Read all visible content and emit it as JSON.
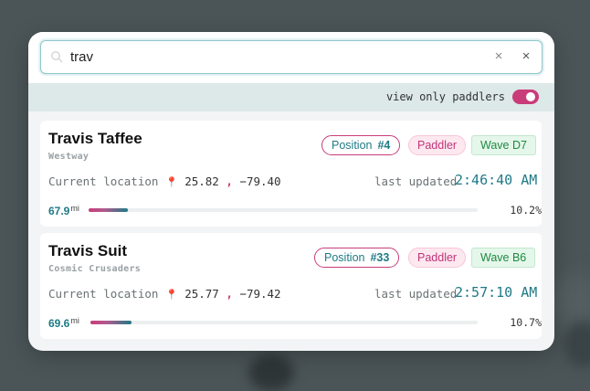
{
  "search": {
    "value": "trav",
    "placeholder": "",
    "icon": "search-icon",
    "clear_label": "×",
    "close_label": "×"
  },
  "filter": {
    "label": "view only paddlers",
    "toggle_on": true
  },
  "results": [
    {
      "name": "Travis Taffee",
      "team": "Westway",
      "position_label": "Position",
      "position_value": "#4",
      "role": "Paddler",
      "wave": "Wave D7",
      "location_label": "Current location",
      "lat": "25.82",
      "lon": "−79.40",
      "updated_label": "last updated",
      "updated_time": "2:46:40 AM",
      "distance": "67.9",
      "distance_unit": "mi",
      "progress_percent": 10.2,
      "progress_text": "10.2%"
    },
    {
      "name": "Travis Suit",
      "team": "Cosmic Crusaders",
      "position_label": "Position",
      "position_value": "#33",
      "role": "Paddler",
      "wave": "Wave B6",
      "location_label": "Current location",
      "lat": "25.77",
      "lon": "−79.42",
      "updated_label": "last updated",
      "updated_time": "2:57:10 AM",
      "distance": "69.6",
      "distance_unit": "mi",
      "progress_percent": 10.7,
      "progress_text": "10.7%"
    }
  ],
  "colors": {
    "accent_pink": "#c93c7a",
    "accent_teal": "#1f7a86"
  }
}
